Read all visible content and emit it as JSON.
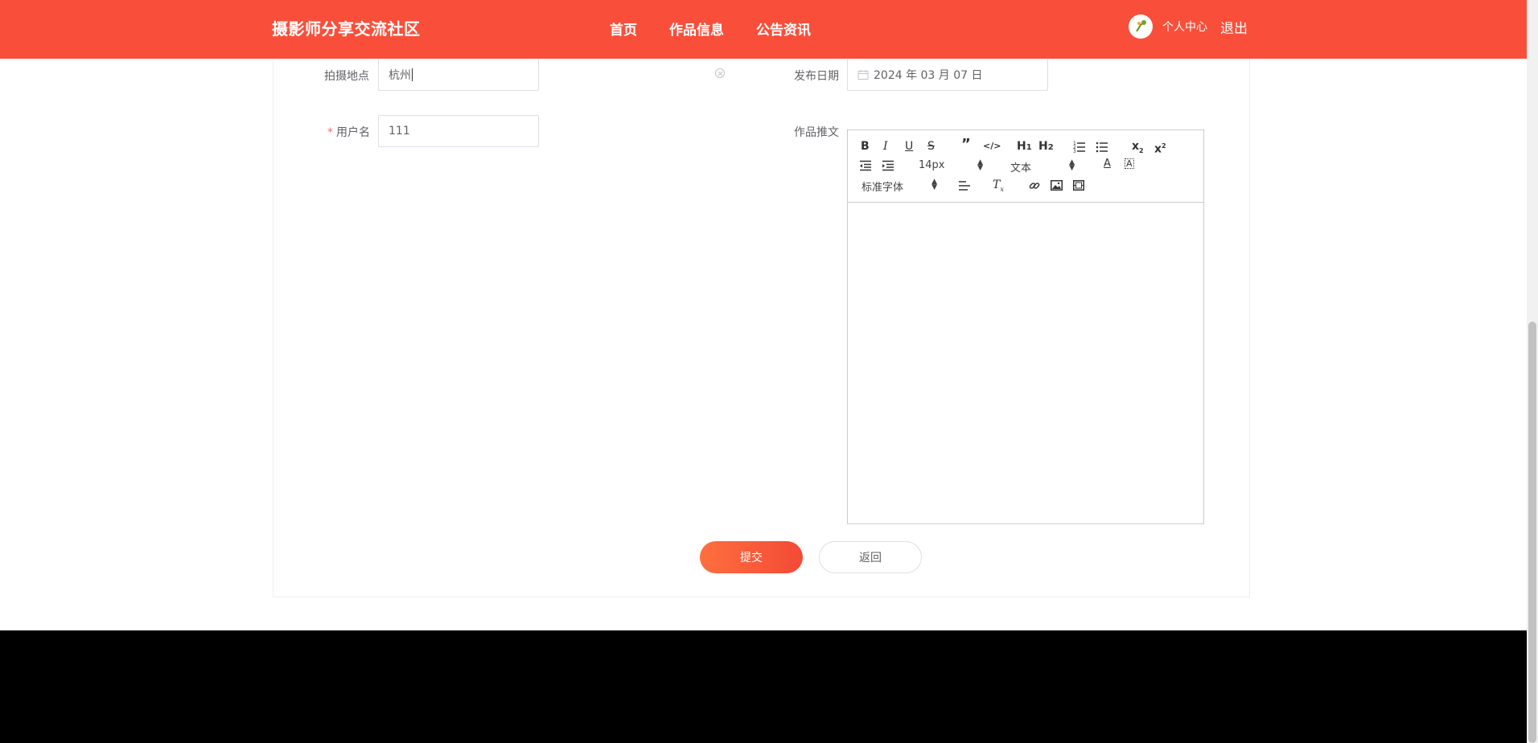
{
  "header": {
    "brand": "摄影师分享交流社区",
    "nav": [
      "首页",
      "作品信息",
      "公告资讯"
    ],
    "personal_center": "个人中心",
    "logout": "退出",
    "bg_color": "#f94f3a"
  },
  "form": {
    "location_label": "拍摄地点",
    "location_value": "杭州",
    "publish_date_label": "发布日期",
    "publish_date_value": "2024 年 03 月 07 日",
    "username_label": "用户名",
    "username_value": "111",
    "content_label": "作品推文",
    "editor": {
      "font_size": "14px",
      "paragraph": "文本",
      "font_family": "标准字体",
      "buttons": [
        "bold",
        "italic",
        "underline",
        "strike",
        "blockquote",
        "code-block",
        "h1",
        "h2",
        "ordered-list",
        "bullet-list",
        "subscript",
        "superscript",
        "outdent",
        "indent",
        "font-color",
        "background-color",
        "align",
        "clean",
        "link",
        "image",
        "video"
      ]
    }
  },
  "actions": {
    "submit": "提交",
    "back": "返回"
  },
  "colors": {
    "accent": "#f94f3a",
    "required": "#f56c6c",
    "footer": "#000000"
  }
}
